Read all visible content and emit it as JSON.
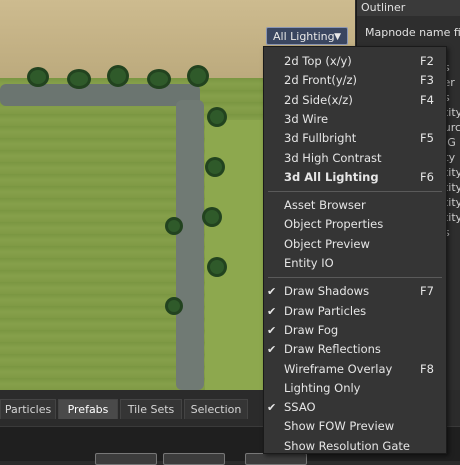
{
  "viewport": {
    "lighting_dropdown": "All Lighting",
    "dropdown_arrow": "▼"
  },
  "outliner": {
    "title": "Outliner",
    "filter_label": "Mapnode name filter",
    "partial_items": [
      "ds",
      "ver",
      "ds",
      "ntity",
      "ourc",
      "e G",
      "tity",
      "ntity",
      "ntity",
      "ntity",
      "ntity",
      "ds"
    ]
  },
  "tabs": [
    "Particles",
    "Prefabs",
    "Tile Sets",
    "Selection"
  ],
  "active_tab": "Prefabs",
  "menu": {
    "groups": [
      [
        {
          "label": "2d Top (x/y)",
          "shortcut": "F2"
        },
        {
          "label": "2d Front(y/z)",
          "shortcut": "F3"
        },
        {
          "label": "2d Side(x/z)",
          "shortcut": "F4"
        },
        {
          "label": "3d Wire",
          "shortcut": ""
        },
        {
          "label": "3d Fullbright",
          "shortcut": "F5"
        },
        {
          "label": "3d High Contrast",
          "shortcut": ""
        },
        {
          "label": "3d All Lighting",
          "shortcut": "F6",
          "bold": true
        }
      ],
      [
        {
          "label": "Asset Browser",
          "shortcut": ""
        },
        {
          "label": "Object Properties",
          "shortcut": ""
        },
        {
          "label": "Object Preview",
          "shortcut": ""
        },
        {
          "label": "Entity IO",
          "shortcut": ""
        }
      ],
      [
        {
          "label": "Draw Shadows",
          "shortcut": "F7",
          "checked": true
        },
        {
          "label": "Draw Particles",
          "shortcut": "",
          "checked": true
        },
        {
          "label": "Draw Fog",
          "shortcut": "",
          "checked": true
        },
        {
          "label": "Draw Reflections",
          "shortcut": "",
          "checked": true
        },
        {
          "label": "Wireframe Overlay",
          "shortcut": "F8",
          "checked": false
        },
        {
          "label": "Lighting Only",
          "shortcut": "",
          "checked": false
        },
        {
          "label": "SSAO",
          "shortcut": "",
          "checked": true
        },
        {
          "label": "Show FOW Preview",
          "shortcut": "",
          "checked": false
        },
        {
          "label": "Show Resolution Gate",
          "shortcut": "",
          "checked": false
        }
      ]
    ]
  }
}
